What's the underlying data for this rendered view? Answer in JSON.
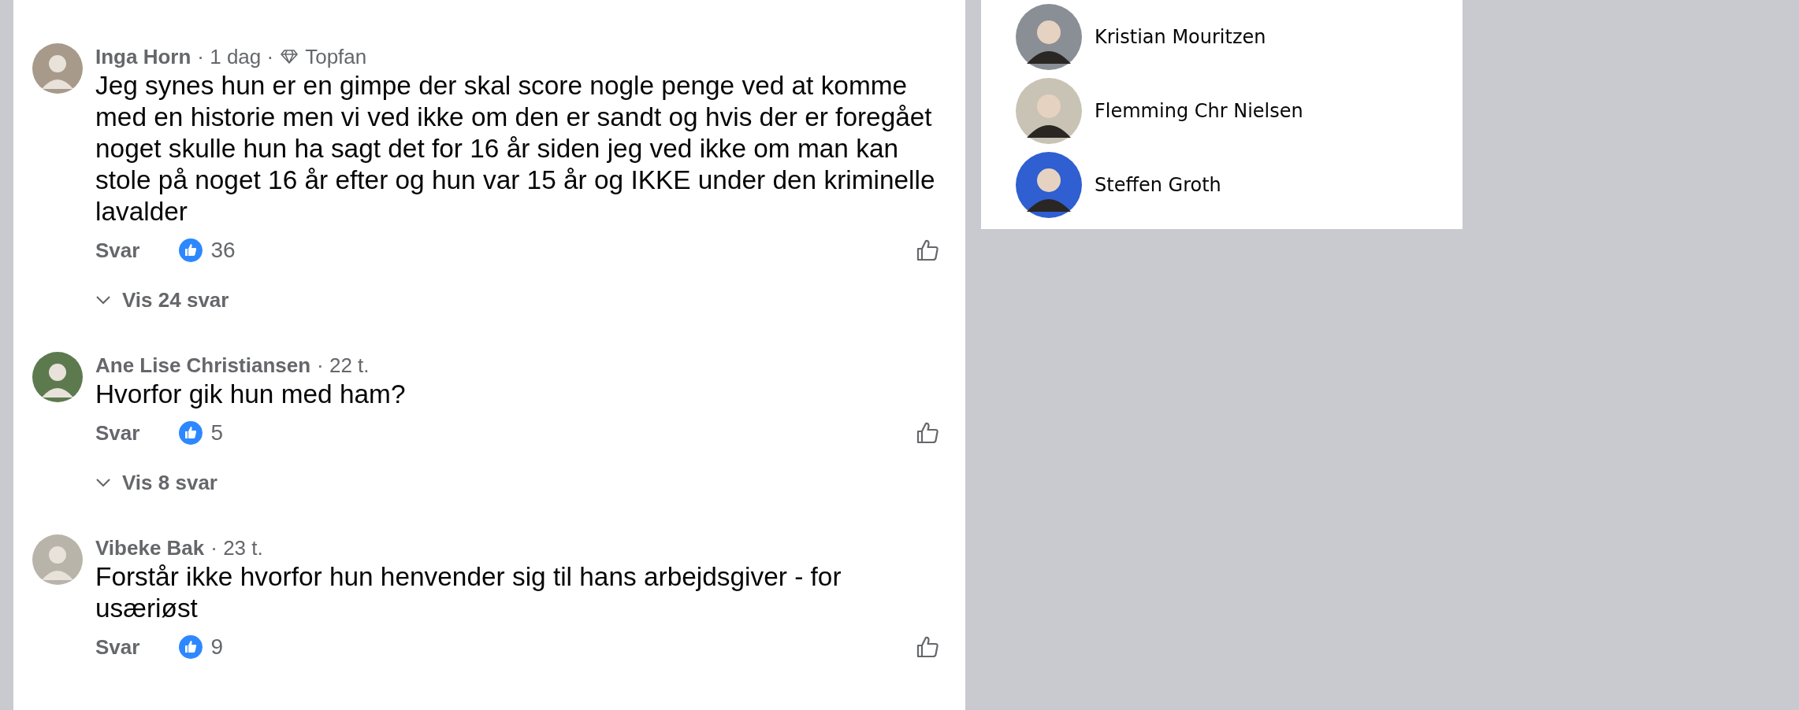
{
  "comments": [
    {
      "author": "Inga Horn",
      "time": "· 1 dag ·",
      "badge": "Topfan",
      "text": "Jeg synes hun er en gimpe der skal score nogle penge ved at komme med en historie men vi ved ikke om den er sandt og hvis der er foregået noget skulle hun ha sagt det for 16 år siden jeg ved ikke om man kan stole på noget 16 år efter og hun var 15 år og IKKE under den kriminelle lavalder",
      "reply": "Svar",
      "likes": "36",
      "replies": "Vis 24 svar"
    },
    {
      "author": "Ane Lise Christiansen",
      "time": "· 22 t.",
      "text": "Hvorfor gik hun med ham?",
      "reply": "Svar",
      "likes": "5",
      "replies": "Vis 8 svar"
    },
    {
      "author": "Vibeke Bak",
      "time": "· 23 t.",
      "text": "Forstår ikke hvorfor hun henvender sig til hans arbejdsgiver - for usæriøst",
      "reply": "Svar",
      "likes": "9"
    }
  ],
  "people": [
    {
      "name": "Kristian Mouritzen",
      "color": "#8a8f96"
    },
    {
      "name": "Flemming Chr Nielsen",
      "color": "#c9c3b5"
    },
    {
      "name": "Steffen Groth",
      "color": "#2f5fd0"
    }
  ]
}
